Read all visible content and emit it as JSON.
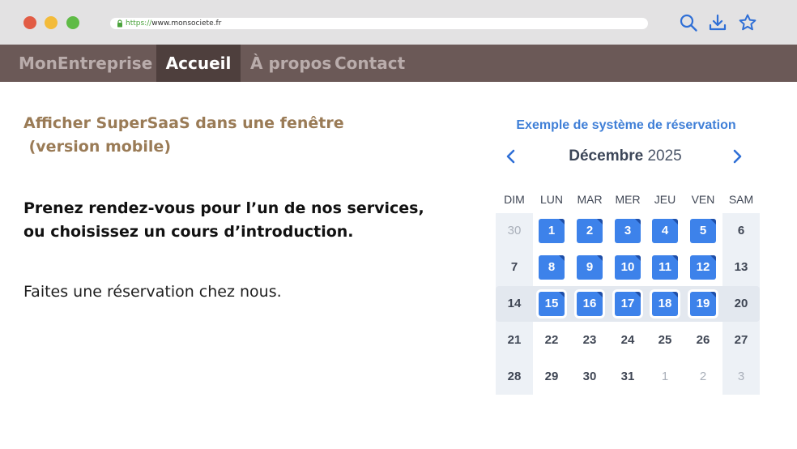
{
  "browser": {
    "url_protocol": "https://",
    "url_host": "www.monsociete.fr",
    "icons": [
      "search-icon",
      "download-icon",
      "star-icon"
    ]
  },
  "nav": {
    "brand": "MonEntreprise",
    "items": [
      {
        "label": "Accueil",
        "active": true
      },
      {
        "label": "À propos",
        "active": false
      },
      {
        "label": "Contact",
        "active": false
      }
    ]
  },
  "content": {
    "title": "Afficher SuperSaaS dans une fenêtre\n (version mobile)",
    "lead": "Prenez rendez-vous pour l’un de nos services,\nou choisissez un cours d’introduction.",
    "paragraph": "Faites une réservation chez nous."
  },
  "calendar": {
    "title": "Exemple de système de réservation",
    "month": "Décembre",
    "year": "2025",
    "weekdays": [
      "DIM",
      "LUN",
      "MAR",
      "MER",
      "JEU",
      "VEN",
      "SAM"
    ],
    "weeks": [
      [
        {
          "d": "30",
          "t": "other"
        },
        {
          "d": "1",
          "t": "avail"
        },
        {
          "d": "2",
          "t": "avail"
        },
        {
          "d": "3",
          "t": "avail"
        },
        {
          "d": "4",
          "t": "avail"
        },
        {
          "d": "5",
          "t": "avail"
        },
        {
          "d": "6",
          "t": "normal"
        }
      ],
      [
        {
          "d": "7",
          "t": "normal"
        },
        {
          "d": "8",
          "t": "avail"
        },
        {
          "d": "9",
          "t": "avail"
        },
        {
          "d": "10",
          "t": "avail"
        },
        {
          "d": "11",
          "t": "avail"
        },
        {
          "d": "12",
          "t": "avail"
        },
        {
          "d": "13",
          "t": "normal"
        }
      ],
      [
        {
          "d": "14",
          "t": "normal"
        },
        {
          "d": "15",
          "t": "avail"
        },
        {
          "d": "16",
          "t": "avail"
        },
        {
          "d": "17",
          "t": "avail"
        },
        {
          "d": "18",
          "t": "avail"
        },
        {
          "d": "19",
          "t": "avail"
        },
        {
          "d": "20",
          "t": "normal"
        }
      ],
      [
        {
          "d": "21",
          "t": "normal"
        },
        {
          "d": "22",
          "t": "normal"
        },
        {
          "d": "23",
          "t": "normal"
        },
        {
          "d": "24",
          "t": "normal"
        },
        {
          "d": "25",
          "t": "normal"
        },
        {
          "d": "26",
          "t": "normal"
        },
        {
          "d": "27",
          "t": "normal"
        }
      ],
      [
        {
          "d": "28",
          "t": "normal"
        },
        {
          "d": "29",
          "t": "normal"
        },
        {
          "d": "30",
          "t": "normal"
        },
        {
          "d": "31",
          "t": "normal"
        },
        {
          "d": "1",
          "t": "other"
        },
        {
          "d": "2",
          "t": "other"
        },
        {
          "d": "3",
          "t": "other"
        }
      ]
    ],
    "highlighted_week": 2,
    "colors": {
      "available": "#3d82ea",
      "accent": "#3f7fd7",
      "nav_bg": "#6b5957",
      "title_brown": "#9a7b56"
    }
  }
}
